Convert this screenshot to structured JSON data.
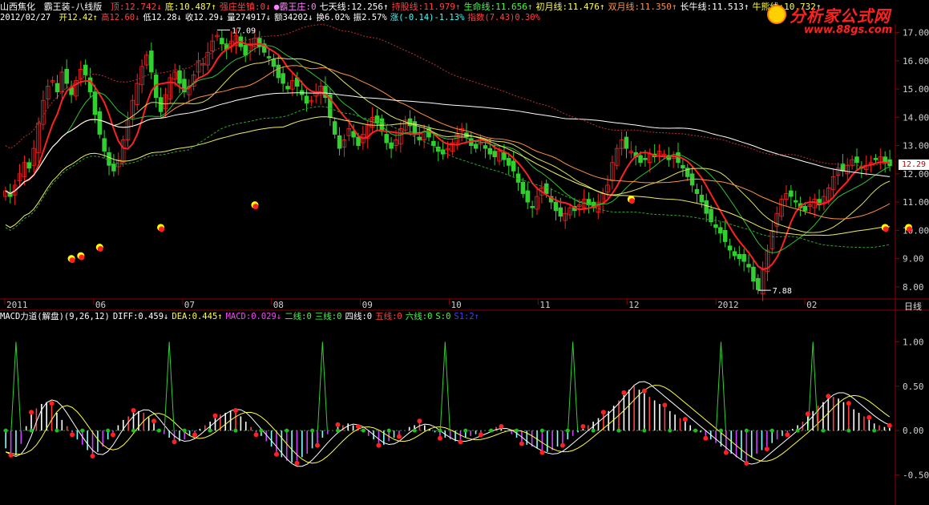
{
  "header": {
    "stock_name": "山西焦化",
    "indicator_name": "霸王装-八线版",
    "items": [
      {
        "label": "顶:12.742",
        "arrow": "↓",
        "color": "#ff4040"
      },
      {
        "label": "底:10.487",
        "arrow": "↑",
        "color": "#ffff40"
      },
      {
        "label": "强庄坐镇:0",
        "arrow": "↓",
        "color": "#ff4040"
      },
      {
        "label": "●霸王庄:0",
        "arrow": "",
        "color": "#ff80ff"
      },
      {
        "label": "七天线:12.256",
        "arrow": "↑",
        "color": "#ffffff"
      },
      {
        "label": "持股线:11.979",
        "arrow": "↑",
        "color": "#ff4040"
      },
      {
        "label": "生命线:11.656",
        "arrow": "↑",
        "color": "#40ff40"
      },
      {
        "label": "初月线:11.476",
        "arrow": "↑",
        "color": "#ffff40"
      },
      {
        "label": "双月线:11.350",
        "arrow": "↑",
        "color": "#ff9040"
      },
      {
        "label": "长牛线:11.513",
        "arrow": "↑",
        "color": "#ffffff"
      },
      {
        "label": "牛熊线:10.732",
        "arrow": "↑",
        "color": "#ffff40"
      }
    ]
  },
  "info": {
    "date": "2012/02/27",
    "items": [
      {
        "label": "开12.42",
        "arrow": "↑",
        "color": "#ffff40"
      },
      {
        "label": "高12.60",
        "arrow": "↓",
        "color": "#ff4040"
      },
      {
        "label": "低12.28",
        "arrow": "↓",
        "color": "#ffffff"
      },
      {
        "label": "收12.29",
        "arrow": "↓",
        "color": "#ffffff"
      },
      {
        "label": "量274917",
        "arrow": "↓",
        "color": "#ffffff"
      },
      {
        "label": "额34202",
        "arrow": "↓",
        "color": "#ffffff"
      },
      {
        "label": "换6.02%",
        "arrow": "",
        "color": "#ffffff"
      },
      {
        "label": "振2.57%",
        "arrow": "",
        "color": "#ffffff"
      },
      {
        "label": "涨(-0.14)-1.13%",
        "arrow": "",
        "color": "#40ffff"
      },
      {
        "label": "指数(7.43)0.30%",
        "arrow": "",
        "color": "#ff4040"
      }
    ]
  },
  "logo": {
    "text": "分析家公式网",
    "url": "www.88gs.com"
  },
  "macd_header": {
    "items": [
      {
        "label": "MACD力道(解盘)(9,26,12)",
        "color": "#ffffff"
      },
      {
        "label": "DIFF:0.459↓",
        "color": "#ffffff"
      },
      {
        "label": "DEA:0.445↑",
        "color": "#ffff40"
      },
      {
        "label": "MACD:0.029↓",
        "color": "#ff40ff"
      },
      {
        "label": "二线:0",
        "color": "#40ff40"
      },
      {
        "label": "三线:0",
        "color": "#40ff40"
      },
      {
        "label": "四线:0",
        "color": "#ffffff"
      },
      {
        "label": "五线:0",
        "color": "#ff4040"
      },
      {
        "label": "六线:0",
        "color": "#40ff40"
      },
      {
        "label": "S:0",
        "color": "#40ff40"
      },
      {
        "label": "S1:2↑",
        "color": "#4040ff"
      }
    ]
  },
  "axis_caption": "日线",
  "last_price_badge": "12.29",
  "chart_data": [
    {
      "type": "candlestick",
      "title": "山西焦化",
      "y_ticks": [
        "17.00",
        "16.00",
        "15.00",
        "14.00",
        "13.00",
        "12.00",
        "11.00",
        "10.00",
        "9.00",
        "8.00"
      ],
      "ylim": [
        7.6,
        17.3
      ],
      "x_ticks": [
        "2011",
        "06",
        "07",
        "08",
        "09",
        "10",
        "11",
        "12",
        "2012",
        "02"
      ],
      "annotations": [
        {
          "text": "17.09",
          "value": 17.09
        },
        {
          "text": "7.88",
          "value": 7.88
        }
      ],
      "last_close": 12.29,
      "close_series": [
        11.4,
        11.2,
        11.6,
        12.0,
        12.4,
        12.2,
        12.9,
        13.8,
        14.6,
        15.1,
        15.3,
        14.9,
        15.6,
        15.2,
        14.8,
        15.3,
        15.7,
        15.5,
        14.9,
        14.1,
        13.4,
        12.8,
        12.3,
        12.1,
        12.5,
        13.2,
        13.9,
        14.6,
        15.2,
        15.8,
        16.2,
        15.6,
        14.7,
        14.2,
        14.8,
        15.4,
        15.6,
        15.2,
        14.9,
        15.1,
        15.5,
        16.0,
        15.9,
        16.3,
        16.7,
        16.9,
        16.6,
        16.4,
        16.7,
        16.9,
        16.5,
        16.2,
        16.6,
        16.8,
        16.5,
        16.3,
        16.1,
        15.8,
        15.4,
        15.2,
        15.0,
        15.3,
        15.1,
        14.8,
        14.5,
        14.6,
        14.9,
        15.1,
        14.7,
        14.0,
        13.4,
        12.9,
        13.2,
        13.6,
        13.3,
        13.0,
        13.4,
        13.7,
        14.0,
        13.8,
        13.5,
        13.1,
        12.9,
        13.2,
        13.6,
        13.9,
        13.7,
        13.4,
        13.2,
        13.5,
        13.3,
        13.0,
        12.8,
        12.7,
        12.9,
        13.1,
        13.4,
        13.6,
        13.3,
        13.0,
        12.9,
        13.1,
        12.9,
        12.7,
        12.6,
        12.8,
        12.5,
        12.3,
        12.1,
        11.7,
        11.3,
        11.0,
        10.8,
        11.2,
        11.5,
        11.3,
        11.0,
        10.7,
        10.5,
        10.6,
        10.8,
        10.7,
        10.9,
        11.1,
        10.9,
        10.8,
        11.0,
        11.3,
        11.6,
        12.4,
        12.9,
        13.2,
        12.9,
        12.8,
        12.6,
        12.4,
        12.5,
        12.7,
        12.6,
        12.8,
        12.7,
        12.5,
        12.6,
        12.4,
        12.2,
        11.9,
        11.6,
        11.3,
        11.0,
        10.6,
        10.3,
        10.1,
        9.9,
        9.6,
        9.3,
        9.1,
        9.0,
        8.9,
        8.7,
        8.2,
        7.9,
        8.6,
        9.3,
        10.0,
        10.6,
        11.1,
        11.3,
        11.2,
        11.0,
        10.8,
        10.7,
        10.9,
        11.1,
        10.9,
        11.2,
        11.5,
        11.9,
        12.2,
        12.1,
        12.3,
        12.5,
        12.4,
        12.2,
        12.3,
        12.4,
        12.5,
        12.6,
        12.4,
        12.29
      ],
      "overlay_lines": [
        {
          "name": "持股线",
          "color": "#ff2020"
        },
        {
          "name": "生命线",
          "color": "#30c030"
        },
        {
          "name": "初月线",
          "color": "#e0e060"
        },
        {
          "name": "双月线",
          "color": "#ff9040"
        },
        {
          "name": "长牛线",
          "color": "#ffffff"
        },
        {
          "name": "牛熊线",
          "color": "#f0f060"
        }
      ],
      "markers": [
        {
          "x_index": 14,
          "value": 9.0
        },
        {
          "x_index": 16,
          "value": 9.1
        },
        {
          "x_index": 20,
          "value": 9.4
        },
        {
          "x_index": 33,
          "value": 10.1
        },
        {
          "x_index": 53,
          "value": 10.9
        },
        {
          "x_index": 133,
          "value": 11.1
        },
        {
          "x_index": 187,
          "value": 10.1
        },
        {
          "x_index": 192,
          "value": 10.1
        },
        {
          "x_index": 199,
          "value": 10.2
        }
      ]
    },
    {
      "type": "bar",
      "title": "MACD力道(解盘)",
      "y_ticks": [
        "1.00",
        "0.50",
        "0.00",
        "-0.50"
      ],
      "ylim": [
        -0.82,
        1.22
      ],
      "macd_series": [
        -0.2,
        -0.25,
        -0.28,
        -0.15,
        0.05,
        0.18,
        0.25,
        0.3,
        0.32,
        0.28,
        0.2,
        0.12,
        0.05,
        -0.02,
        -0.1,
        -0.16,
        -0.22,
        -0.26,
        -0.24,
        -0.18,
        -0.1,
        -0.02,
        0.06,
        0.12,
        0.16,
        0.2,
        0.22,
        0.2,
        0.15,
        0.08,
        0.02,
        -0.04,
        -0.08,
        -0.1,
        -0.12,
        -0.1,
        -0.06,
        -0.02,
        0.02,
        0.06,
        0.1,
        0.14,
        0.18,
        0.2,
        0.22,
        0.2,
        0.16,
        0.1,
        0.04,
        -0.02,
        -0.06,
        -0.12,
        -0.18,
        -0.24,
        -0.3,
        -0.34,
        -0.36,
        -0.34,
        -0.3,
        -0.26,
        -0.2,
        -0.14,
        -0.08,
        -0.04,
        0.0,
        0.04,
        0.06,
        0.08,
        0.06,
        0.02,
        -0.02,
        -0.06,
        -0.1,
        -0.14,
        -0.16,
        -0.12,
        -0.08,
        -0.04,
        0.0,
        0.04,
        0.06,
        0.08,
        0.06,
        0.02,
        -0.02,
        -0.06,
        -0.08,
        -0.1,
        -0.12,
        -0.1,
        -0.08,
        -0.06,
        -0.04,
        -0.02,
        0.0,
        0.02,
        0.04,
        0.02,
        0.0,
        -0.04,
        -0.08,
        -0.12,
        -0.16,
        -0.18,
        -0.2,
        -0.22,
        -0.24,
        -0.22,
        -0.18,
        -0.14,
        -0.1,
        -0.06,
        -0.02,
        0.02,
        0.06,
        0.1,
        0.14,
        0.18,
        0.22,
        0.28,
        0.34,
        0.4,
        0.46,
        0.5,
        0.46,
        0.42,
        0.38,
        0.34,
        0.3,
        0.26,
        0.22,
        0.18,
        0.14,
        0.1,
        0.06,
        0.02,
        -0.02,
        -0.06,
        -0.1,
        -0.14,
        -0.18,
        -0.22,
        -0.26,
        -0.3,
        -0.32,
        -0.34,
        -0.3,
        -0.26,
        -0.22,
        -0.18,
        -0.14,
        -0.1,
        -0.06,
        -0.02,
        0.02,
        0.06,
        0.1,
        0.16,
        0.22,
        0.28,
        0.32,
        0.36,
        0.38,
        0.36,
        0.32,
        0.28,
        0.24,
        0.2,
        0.16,
        0.12,
        0.08,
        0.06,
        0.04,
        0.03
      ],
      "diff_color": "#ffffff",
      "dea_color": "#ffff40"
    }
  ]
}
